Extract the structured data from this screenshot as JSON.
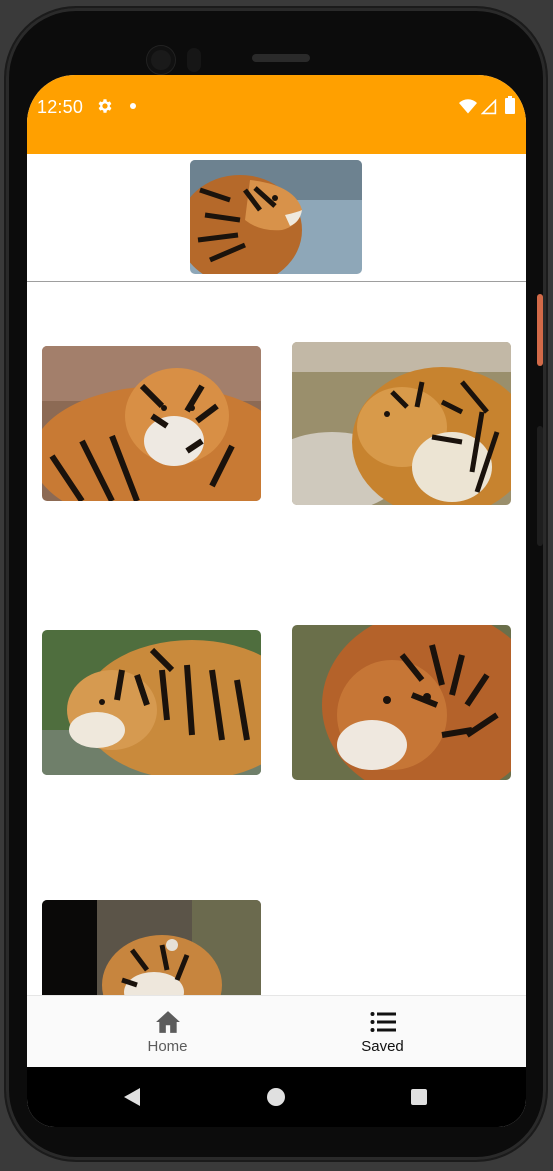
{
  "status_bar": {
    "time": "12:50",
    "icons": [
      "gear-icon",
      "notification-dot-icon",
      "wifi-icon",
      "signal-icon",
      "battery-icon"
    ],
    "background_color": "#ffa000"
  },
  "header": {
    "selected_image": "tiger-head-profile"
  },
  "gallery": {
    "images": [
      "tiger-lounging",
      "tiger-by-water",
      "tiger-side-profile",
      "tiger-face-closeup",
      "tiger-in-forest"
    ]
  },
  "bottom_nav": {
    "items": [
      {
        "label": "Home",
        "icon": "home-icon"
      },
      {
        "label": "Saved",
        "icon": "list-icon"
      }
    ]
  },
  "system_nav": {
    "icons": [
      "back-icon",
      "home-circle-icon",
      "recents-icon"
    ]
  }
}
